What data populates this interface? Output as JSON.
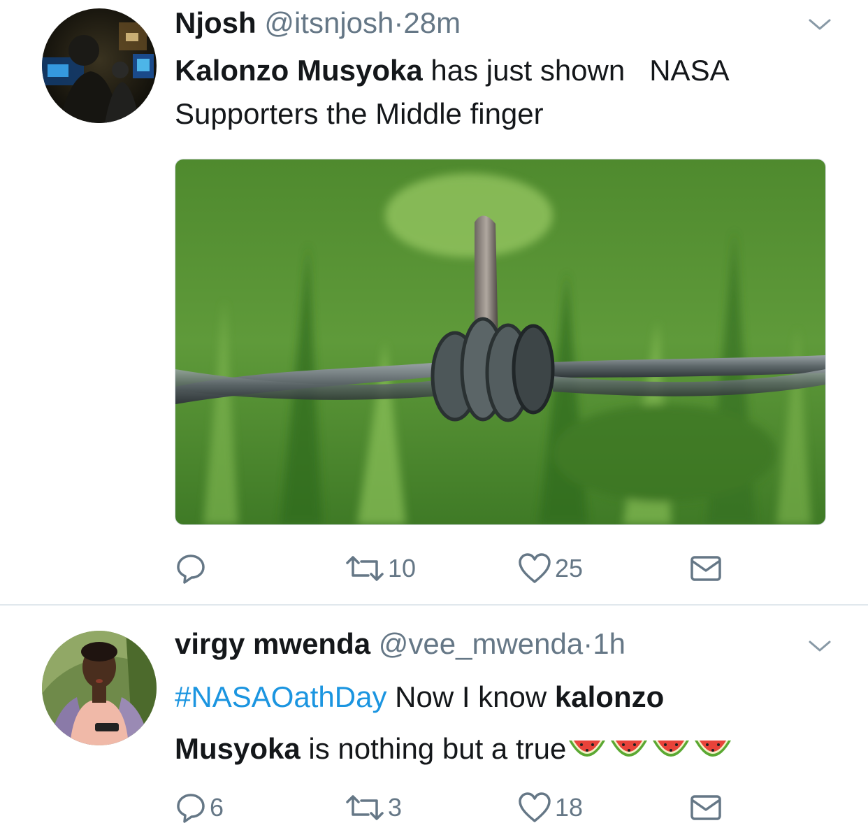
{
  "tweets": [
    {
      "name": "Njosh",
      "handle": "@itsnjosh",
      "dot": "·",
      "time": "28m",
      "text_bold": "Kalonzo Musyoka",
      "text_rest": " has just shown   NASA",
      "text_line2": "Supporters the Middle finger",
      "avatar_icon": "avatar-photo",
      "media_icon": "barbed-wire-photo",
      "actions": {
        "reply": "",
        "retweet": "10",
        "like": "25",
        "dm": ""
      }
    },
    {
      "name": "virgy mwenda",
      "handle": "@vee_mwenda",
      "dot": "·",
      "time": "1h",
      "hashtag": "#NASAOathDay",
      "text_mid": " Now I know ",
      "text_bold1": "kalonzo",
      "text_bold2": "Musyoka",
      "text_rest": " is nothing but a true",
      "emoji": "🍉🍉🍉🍉",
      "avatar_icon": "avatar-photo",
      "actions": {
        "reply": "6",
        "retweet": "3",
        "like": "18",
        "dm": ""
      }
    }
  ],
  "colors": {
    "secondary": "#657786",
    "link": "#1b95e0",
    "text": "#14171a",
    "divider": "#e1e8ed"
  }
}
